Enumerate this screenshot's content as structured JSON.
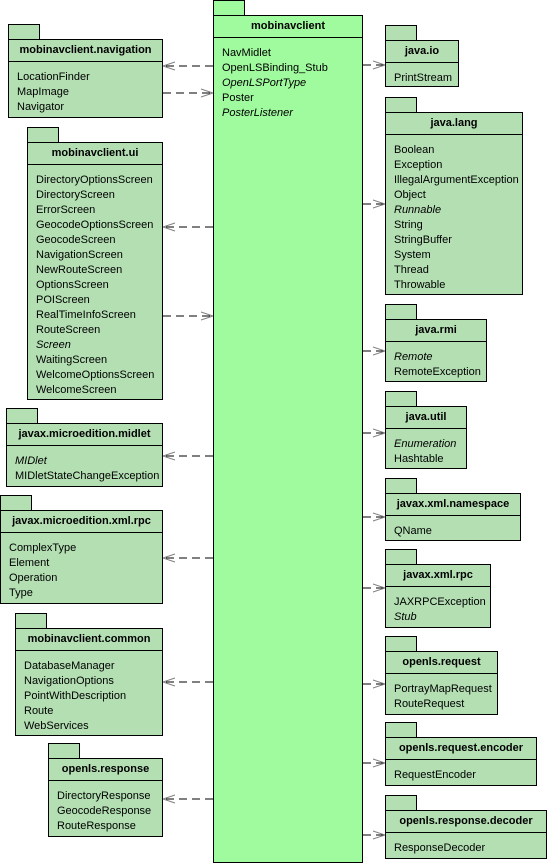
{
  "colors": {
    "main_package": "#a0fa9e",
    "package": "#b3dfb3",
    "line": "#000000",
    "arrowhead": "#808080"
  },
  "packages": [
    {
      "id": "center",
      "name": "mobinavclient",
      "items": [
        {
          "t": "NavMidlet"
        },
        {
          "t": "OpenLSBinding_Stub"
        },
        {
          "t": "OpenLSPortType",
          "italic": true
        },
        {
          "t": "Poster"
        },
        {
          "t": "PosterListener",
          "italic": true
        }
      ]
    },
    {
      "id": "navigation",
      "name": "mobinavclient.navigation",
      "items": [
        {
          "t": "LocationFinder"
        },
        {
          "t": "MapImage"
        },
        {
          "t": "Navigator"
        }
      ]
    },
    {
      "id": "ui",
      "name": "mobinavclient.ui",
      "items": [
        {
          "t": "DirectoryOptionsScreen"
        },
        {
          "t": "DirectoryScreen"
        },
        {
          "t": "ErrorScreen"
        },
        {
          "t": "GeocodeOptionsScreen"
        },
        {
          "t": "GeocodeScreen"
        },
        {
          "t": "NavigationScreen"
        },
        {
          "t": "NewRouteScreen"
        },
        {
          "t": "OptionsScreen"
        },
        {
          "t": "POIScreen"
        },
        {
          "t": "RealTimeInfoScreen"
        },
        {
          "t": "RouteScreen"
        },
        {
          "t": "Screen",
          "italic": true
        },
        {
          "t": "WaitingScreen"
        },
        {
          "t": "WelcomeOptionsScreen"
        },
        {
          "t": "WelcomeScreen"
        }
      ]
    },
    {
      "id": "midlet",
      "name": "javax.microedition.midlet",
      "items": [
        {
          "t": "MIDlet",
          "italic": true
        },
        {
          "t": "MIDletStateChangeException"
        }
      ]
    },
    {
      "id": "mexmlrpc",
      "name": "javax.microedition.xml.rpc",
      "items": [
        {
          "t": "ComplexType"
        },
        {
          "t": "Element"
        },
        {
          "t": "Operation"
        },
        {
          "t": "Type"
        }
      ]
    },
    {
      "id": "common",
      "name": "mobinavclient.common",
      "items": [
        {
          "t": "DatabaseManager"
        },
        {
          "t": "NavigationOptions"
        },
        {
          "t": "PointWithDescription"
        },
        {
          "t": "Route"
        },
        {
          "t": "WebServices"
        }
      ]
    },
    {
      "id": "response",
      "name": "openls.response",
      "items": [
        {
          "t": "DirectoryResponse"
        },
        {
          "t": "GeocodeResponse"
        },
        {
          "t": "RouteResponse"
        }
      ]
    },
    {
      "id": "javaio",
      "name": "java.io",
      "items": [
        {
          "t": "PrintStream"
        }
      ]
    },
    {
      "id": "javalang",
      "name": "java.lang",
      "items": [
        {
          "t": "Boolean"
        },
        {
          "t": "Exception"
        },
        {
          "t": "IllegalArgumentException"
        },
        {
          "t": "Object"
        },
        {
          "t": "Runnable",
          "italic": true
        },
        {
          "t": "String"
        },
        {
          "t": "StringBuffer"
        },
        {
          "t": "System"
        },
        {
          "t": "Thread"
        },
        {
          "t": "Throwable"
        }
      ]
    },
    {
      "id": "javarmi",
      "name": "java.rmi",
      "items": [
        {
          "t": "Remote",
          "italic": true
        },
        {
          "t": "RemoteException"
        }
      ]
    },
    {
      "id": "javautil",
      "name": "java.util",
      "items": [
        {
          "t": "Enumeration",
          "italic": true
        },
        {
          "t": "Hashtable"
        }
      ]
    },
    {
      "id": "xmlns",
      "name": "javax.xml.namespace",
      "items": [
        {
          "t": "QName"
        }
      ]
    },
    {
      "id": "xmlrpc",
      "name": "javax.xml.rpc",
      "items": [
        {
          "t": "JAXRPCException"
        },
        {
          "t": "Stub",
          "italic": true
        }
      ]
    },
    {
      "id": "request",
      "name": "openls.request",
      "items": [
        {
          "t": "PortrayMapRequest"
        },
        {
          "t": "RouteRequest"
        }
      ]
    },
    {
      "id": "encoder",
      "name": "openls.request.encoder",
      "items": [
        {
          "t": "RequestEncoder"
        }
      ]
    },
    {
      "id": "decoder",
      "name": "openls.response.decoder",
      "items": [
        {
          "t": "ResponseDecoder"
        }
      ]
    }
  ],
  "dependencies": [
    {
      "from": "center",
      "to": "navigation"
    },
    {
      "from": "navigation",
      "to": "center"
    },
    {
      "from": "center",
      "to": "ui"
    },
    {
      "from": "ui",
      "to": "center"
    },
    {
      "from": "center",
      "to": "midlet"
    },
    {
      "from": "center",
      "to": "mexmlrpc"
    },
    {
      "from": "center",
      "to": "common"
    },
    {
      "from": "center",
      "to": "response"
    },
    {
      "from": "center",
      "to": "javaio"
    },
    {
      "from": "center",
      "to": "javalang"
    },
    {
      "from": "center",
      "to": "javarmi"
    },
    {
      "from": "center",
      "to": "javautil"
    },
    {
      "from": "center",
      "to": "xmlns"
    },
    {
      "from": "center",
      "to": "xmlrpc"
    },
    {
      "from": "center",
      "to": "request"
    },
    {
      "from": "center",
      "to": "encoder"
    },
    {
      "from": "center",
      "to": "decoder"
    }
  ]
}
